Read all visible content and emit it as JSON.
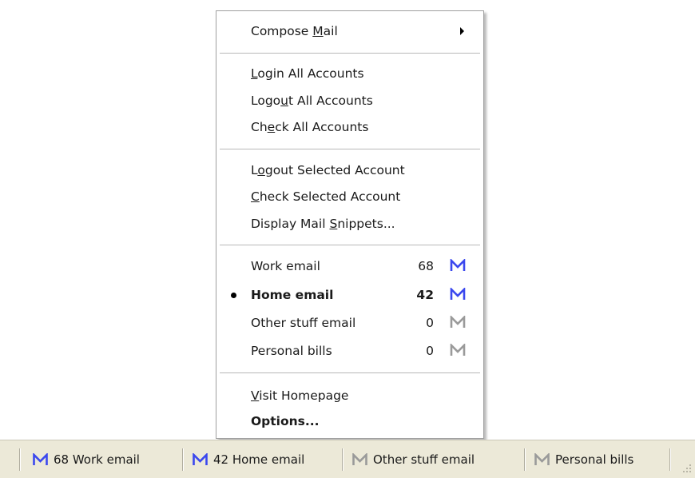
{
  "menu": {
    "compose": {
      "pre": "Compose ",
      "acc": "M",
      "post": "ail"
    },
    "group_accounts": {
      "login": {
        "pre": "",
        "acc": "L",
        "post": "ogin All Accounts"
      },
      "logout": {
        "pre": "Logo",
        "acc": "u",
        "post": "t All Accounts"
      },
      "check": {
        "pre": "Ch",
        "acc": "e",
        "post": "ck All Accounts"
      }
    },
    "group_selected": {
      "logout": {
        "pre": "L",
        "acc": "o",
        "post": "gout Selected Account"
      },
      "check": {
        "pre": "",
        "acc": "C",
        "post": "heck Selected Account"
      },
      "snippets": {
        "pre": "Display Mail ",
        "acc": "S",
        "post": "nippets..."
      }
    },
    "accounts": [
      {
        "name": "Work email",
        "count": "68",
        "icon": "mail-unread-icon",
        "selected": false
      },
      {
        "name": "Home email",
        "count": "42",
        "icon": "mail-unread-icon",
        "selected": true
      },
      {
        "name": "Other stuff email",
        "count": "0",
        "icon": "mail-read-icon",
        "selected": false
      },
      {
        "name": "Personal bills",
        "count": "0",
        "icon": "mail-read-icon",
        "selected": false
      }
    ],
    "visit": {
      "pre": "",
      "acc": "V",
      "post": "isit Homepage"
    },
    "options": "Options..."
  },
  "taskbar": {
    "items": [
      {
        "label": "68 Work email",
        "icon": "mail-unread-icon"
      },
      {
        "label": "42 Home email",
        "icon": "mail-unread-icon"
      },
      {
        "label": "Other stuff email",
        "icon": "mail-read-icon"
      },
      {
        "label": "Personal bills",
        "icon": "mail-read-icon"
      }
    ]
  },
  "colors": {
    "unread_icon": "#3b48ee",
    "read_icon": "#9a9a9a",
    "taskbar_bg": "#ece9d8"
  }
}
